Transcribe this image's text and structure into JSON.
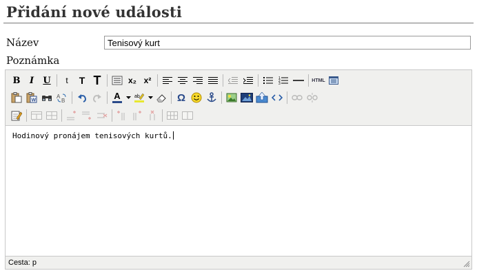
{
  "page": {
    "title": "Přidání nové události"
  },
  "form": {
    "name_label": "Název",
    "name_value": "Tenisový kurt",
    "note_label": "Poznámka"
  },
  "editor": {
    "content": "Hodinový pronájem tenisových kurtů.",
    "path_label": "Cesta:",
    "path_value": "p",
    "toolbar": {
      "bold": "B",
      "italic": "I",
      "underline": "U",
      "font_small": "t",
      "font_medium": "T",
      "font_large": "T",
      "subscript": "x₂",
      "superscript": "x²",
      "html": "HTML",
      "omega": "Ω",
      "font_color": "A"
    }
  }
}
